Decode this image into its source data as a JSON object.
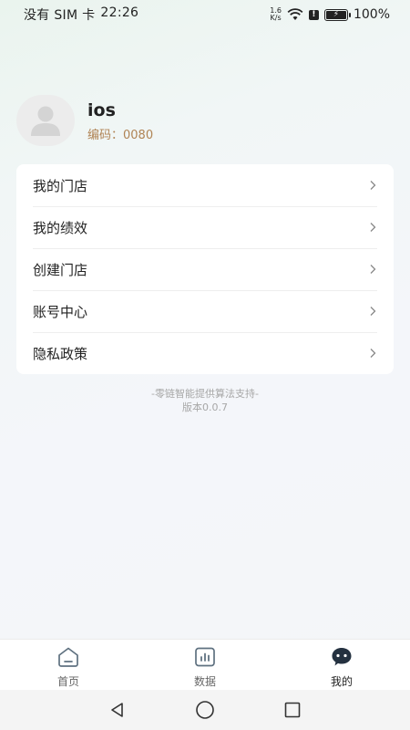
{
  "status_bar": {
    "carrier": "没有 SIM 卡",
    "time": "22:26",
    "net_speed_value": "1.6",
    "net_speed_unit": "K/s",
    "battery": "100%",
    "battery_level": 1.0
  },
  "profile": {
    "username": "ios",
    "code": "编码：0080"
  },
  "menu": {
    "items": [
      {
        "label": "我的门店"
      },
      {
        "label": "我的绩效"
      },
      {
        "label": "创建门店"
      },
      {
        "label": "账号中心"
      },
      {
        "label": "隐私政策"
      }
    ]
  },
  "credit": {
    "line1": "-零链智能提供算法支持-",
    "line2": "版本0.0.7"
  },
  "tabs": [
    {
      "label": "首页",
      "icon": "home-icon",
      "active": false
    },
    {
      "label": "数据",
      "icon": "chart-icon",
      "active": false
    },
    {
      "label": "我的",
      "icon": "profile-chat-icon",
      "active": true
    }
  ],
  "colors": {
    "accent_code": "#b08455",
    "active_tab": "#222222",
    "inactive_tab": "#666666"
  }
}
